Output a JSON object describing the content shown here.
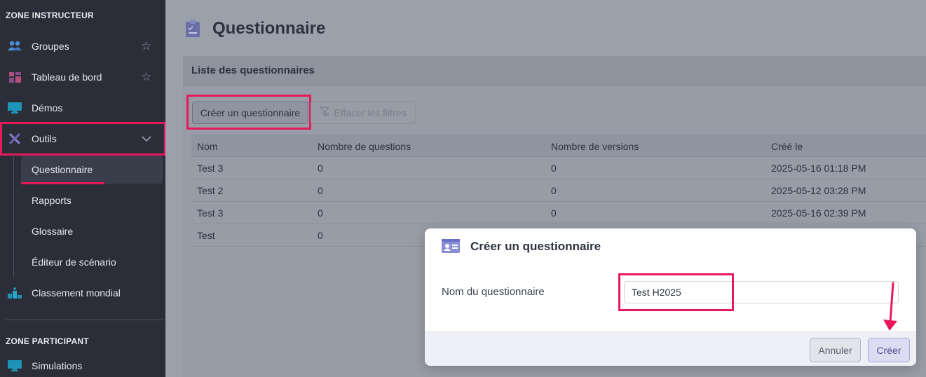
{
  "sidebar": {
    "zone_instructor": "ZONE INSTRUCTEUR",
    "zone_participant": "ZONE PARTICIPANT",
    "items": [
      {
        "label": "Groupes",
        "icon": "users-icon"
      },
      {
        "label": "Tableau de bord",
        "icon": "dashboard-icon"
      },
      {
        "label": "Démos",
        "icon": "monitor-icon"
      },
      {
        "label": "Outils",
        "icon": "tools-icon"
      },
      {
        "label": "Classement mondial",
        "icon": "podium-icon"
      },
      {
        "label": "Simulations",
        "icon": "monitor-icon"
      }
    ],
    "sub_items": [
      {
        "label": "Questionnaire"
      },
      {
        "label": "Rapports"
      },
      {
        "label": "Glossaire"
      },
      {
        "label": "Éditeur de scénario"
      }
    ]
  },
  "main": {
    "title": "Questionnaire",
    "card_title": "Liste des questionnaires",
    "create_button": "Créer un questionnaire",
    "clear_filters_button": "Effacer les filtres",
    "table": {
      "headers": [
        "Nom",
        "Nombre de questions",
        "Nombre de versions",
        "Créé le"
      ],
      "rows": [
        [
          "Test 3",
          "0",
          "0",
          "2025-05-16 01:18 PM"
        ],
        [
          "Test 2",
          "0",
          "0",
          "2025-05-12 03:28 PM"
        ],
        [
          "Test 3",
          "0",
          "0",
          "2025-05-16 02:39 PM"
        ],
        [
          "Test",
          "0",
          "",
          ""
        ]
      ]
    }
  },
  "modal": {
    "title": "Créer un questionnaire",
    "field_label": "Nom du questionnaire",
    "field_value": "Test H2025",
    "cancel_label": "Annuler",
    "create_label": "Créer"
  },
  "colors": {
    "annotation": "#e8195a",
    "sidebar_bg": "#2b2e38",
    "accent": "#6b6fc4"
  }
}
